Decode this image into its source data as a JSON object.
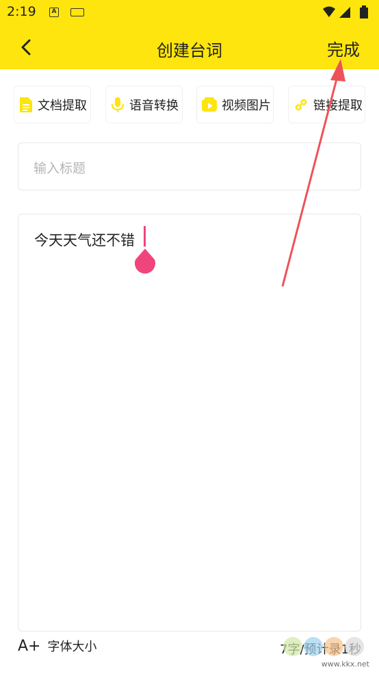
{
  "status_bar": {
    "time": "2:19",
    "icons": [
      "a-notification-icon",
      "keyboard-icon",
      "wifi-icon",
      "signal-icon",
      "battery-icon"
    ]
  },
  "nav": {
    "title": "创建台词",
    "done_label": "完成",
    "back_icon": "chevron-left-icon"
  },
  "tools": [
    {
      "label": "文档提取",
      "icon": "document-icon"
    },
    {
      "label": "语音转换",
      "icon": "microphone-icon"
    },
    {
      "label": "视频图片",
      "icon": "video-icon"
    },
    {
      "label": "链接提取",
      "icon": "link-icon"
    }
  ],
  "title_input": {
    "placeholder": "输入标题",
    "value": ""
  },
  "content": {
    "text": "今天天气还不错"
  },
  "footer": {
    "font_size_icon_text": "A+",
    "font_size_label": "字体大小",
    "word_count": "7字/预计录1秒"
  },
  "watermark": {
    "text": "www.kkx.net"
  },
  "colors": {
    "accent_yellow": "#FDE50D",
    "cursor_pink": "#F0457C",
    "annotation_red": "#EE5258"
  }
}
